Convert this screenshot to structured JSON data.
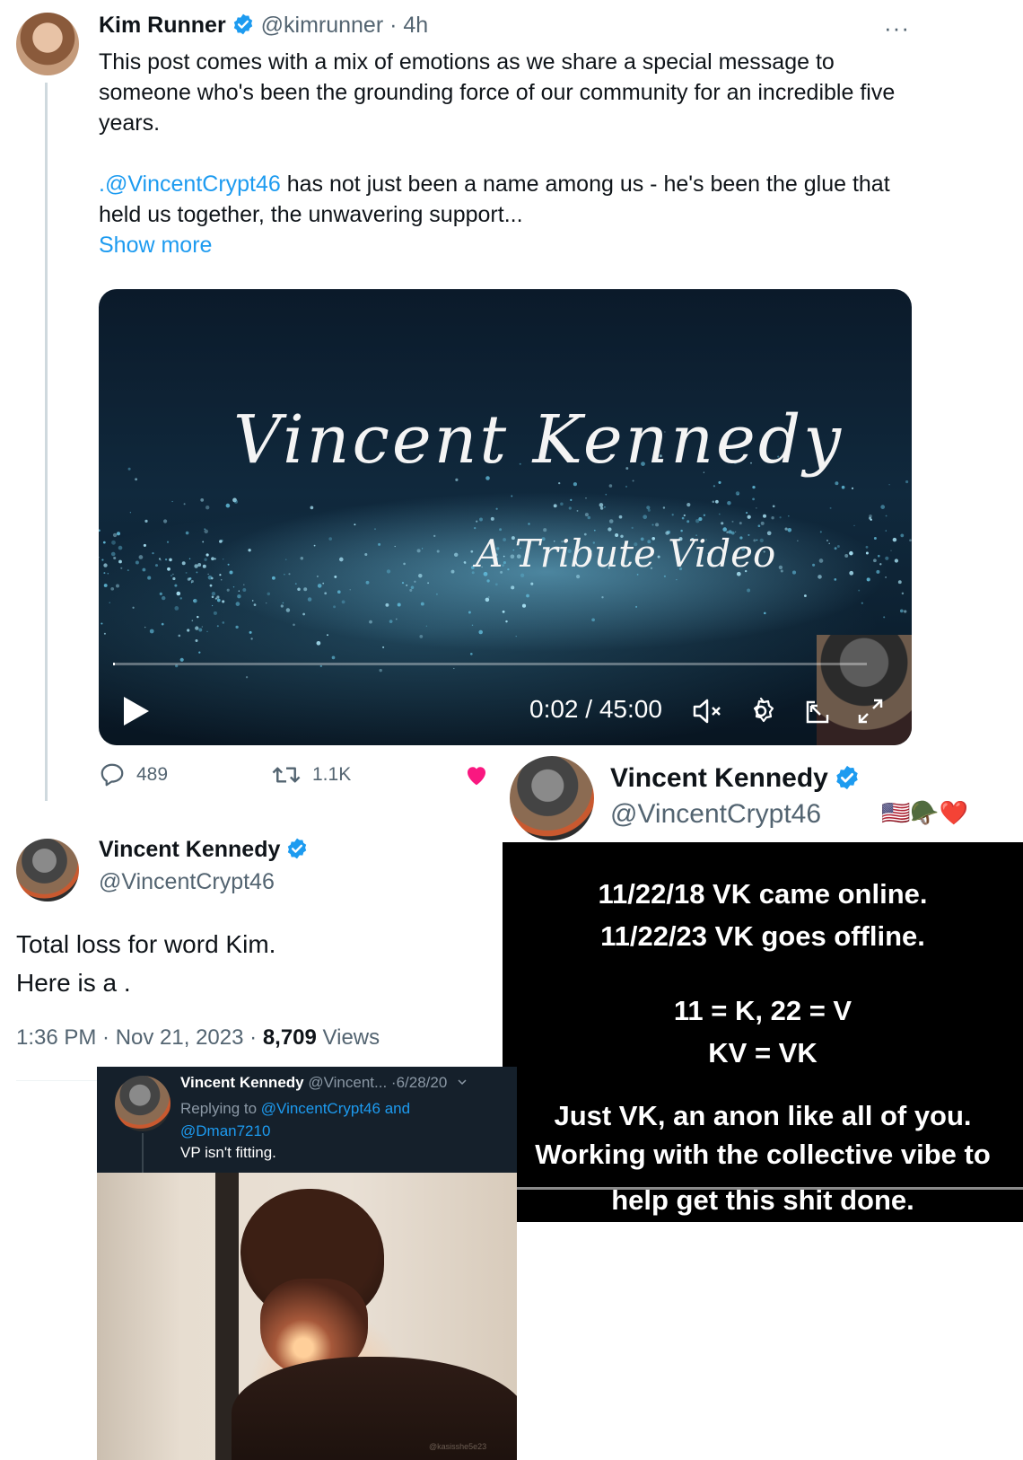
{
  "kim_tweet": {
    "name": "Kim Runner",
    "handle": "@kimrunner",
    "time": "· 4h",
    "more": "···",
    "paragraph1": "This post comes with a mix of emotions as we share a special message to someone who's been the grounding force of our community for an incredible five years.",
    "mention": ".@VincentCrypt46",
    "paragraph2_rest": " has not just been a name among us - he's been the glue that held us together,  the unwavering support...",
    "show_more": "Show more",
    "video": {
      "title": "Vincent Kennedy",
      "subtitle": "A Tribute Video",
      "time": "0:02 / 45:00",
      "progress": 0.0007
    },
    "actions": {
      "replies": "489",
      "reposts": "1.1K"
    }
  },
  "vk_profile": {
    "name": "Vincent Kennedy",
    "handle": "@VincentCrypt46",
    "emojis": "🇺🇸🪖❤️"
  },
  "vk_reply": {
    "name": "Vincent Kennedy",
    "handle": "@VincentCrypt46",
    "line1": "Total loss for word Kim.",
    "line2": "Here is a .",
    "time": "1:36 PM · Nov 21, 2023 · ",
    "views_count": "8,709",
    "views_label": " Views"
  },
  "black_panel": {
    "lines": [
      "11/22/18 VK came online.",
      "11/22/23 VK goes offline.",
      "11 = K, 22 = V",
      "KV = VK",
      "Just VK, an anon like all of you.",
      "Working with the collective vibe to",
      "help get this shit done."
    ]
  },
  "dark_card": {
    "name": "Vincent Kennedy",
    "handle": "@Vincent...",
    "date": "·6/28/20",
    "replying_prefix": "Replying to ",
    "replying_to_1": "@VincentCrypt46",
    "replying_and": " and",
    "replying_to_2": "@Dman7210",
    "text": "VP isn't fitting."
  },
  "photo": {
    "watermark": "@kasisshe5e23"
  },
  "colors": {
    "link": "#1d9bf0",
    "verified": "#1d9bf0",
    "like": "#f91880"
  }
}
